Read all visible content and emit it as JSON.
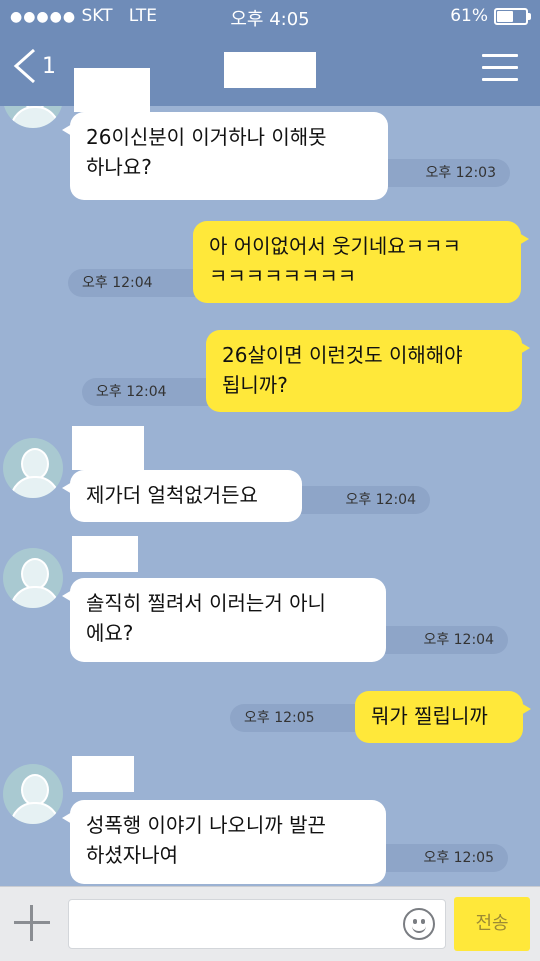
{
  "status": {
    "signal": "●●●●●",
    "carrier": "SKT",
    "network": "LTE",
    "time": "오후 4:05",
    "battery": "61%",
    "battery_level": 0.61
  },
  "header": {
    "back_count": "1"
  },
  "messages": [
    {
      "side": "in",
      "text": "26이신분이 이거하나 이해못\n하나요?",
      "time": "오후 12:03"
    },
    {
      "side": "out",
      "text": "아 어이없어서 웃기네요ㅋㅋㅋ\nㅋㅋㅋㅋㅋㅋㅋㅋ",
      "time": "오후 12:04"
    },
    {
      "side": "out",
      "text": "26살이면 이런것도 이해해야\n됩니까?",
      "time": "오후 12:04"
    },
    {
      "side": "in",
      "text": "제가더 얼척없거든요",
      "time": "오후 12:04"
    },
    {
      "side": "in",
      "text": "솔직히 찔려서 이러는거 아니\n에요?",
      "time": "오후 12:04"
    },
    {
      "side": "out",
      "text": "뭐가 찔립니까",
      "time": "오후 12:05"
    },
    {
      "side": "in",
      "text": "성폭행 이야기 나오니까 발끈\n하셨자나여",
      "time": "오후 12:05"
    }
  ],
  "input": {
    "send_label": "전송"
  },
  "colors": {
    "background": "#9bb2d3",
    "header": "#6f8cb8",
    "outgoing_bubble": "#ffe83a",
    "incoming_bubble": "#ffffff"
  }
}
